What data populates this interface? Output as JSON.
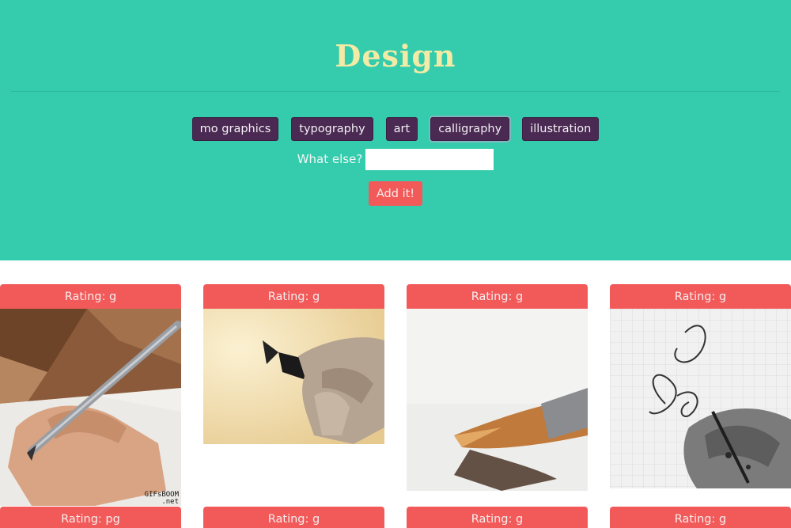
{
  "header": {
    "title": "Design",
    "tags": [
      "mo graphics",
      "typography",
      "art",
      "calligraphy",
      "illustration"
    ],
    "active_tag": "calligraphy",
    "prompt_label": "What else?",
    "input_value": "",
    "add_button_label": "Add it!"
  },
  "colors": {
    "header_bg": "#34ccad",
    "title": "#f3eaa6",
    "tag_bg": "#4a2a52",
    "accent_red": "#f25a5a"
  },
  "gifs": [
    {
      "rating_label": "Rating: g",
      "watermark": "GIFsBOOM\n.net"
    },
    {
      "rating_label": "Rating: g"
    },
    {
      "rating_label": "Rating: g"
    },
    {
      "rating_label": "Rating: g"
    },
    {
      "rating_label": "Rating: pg"
    },
    {
      "rating_label": "Rating: g"
    },
    {
      "rating_label": "Rating: g"
    },
    {
      "rating_label": "Rating: g"
    }
  ]
}
